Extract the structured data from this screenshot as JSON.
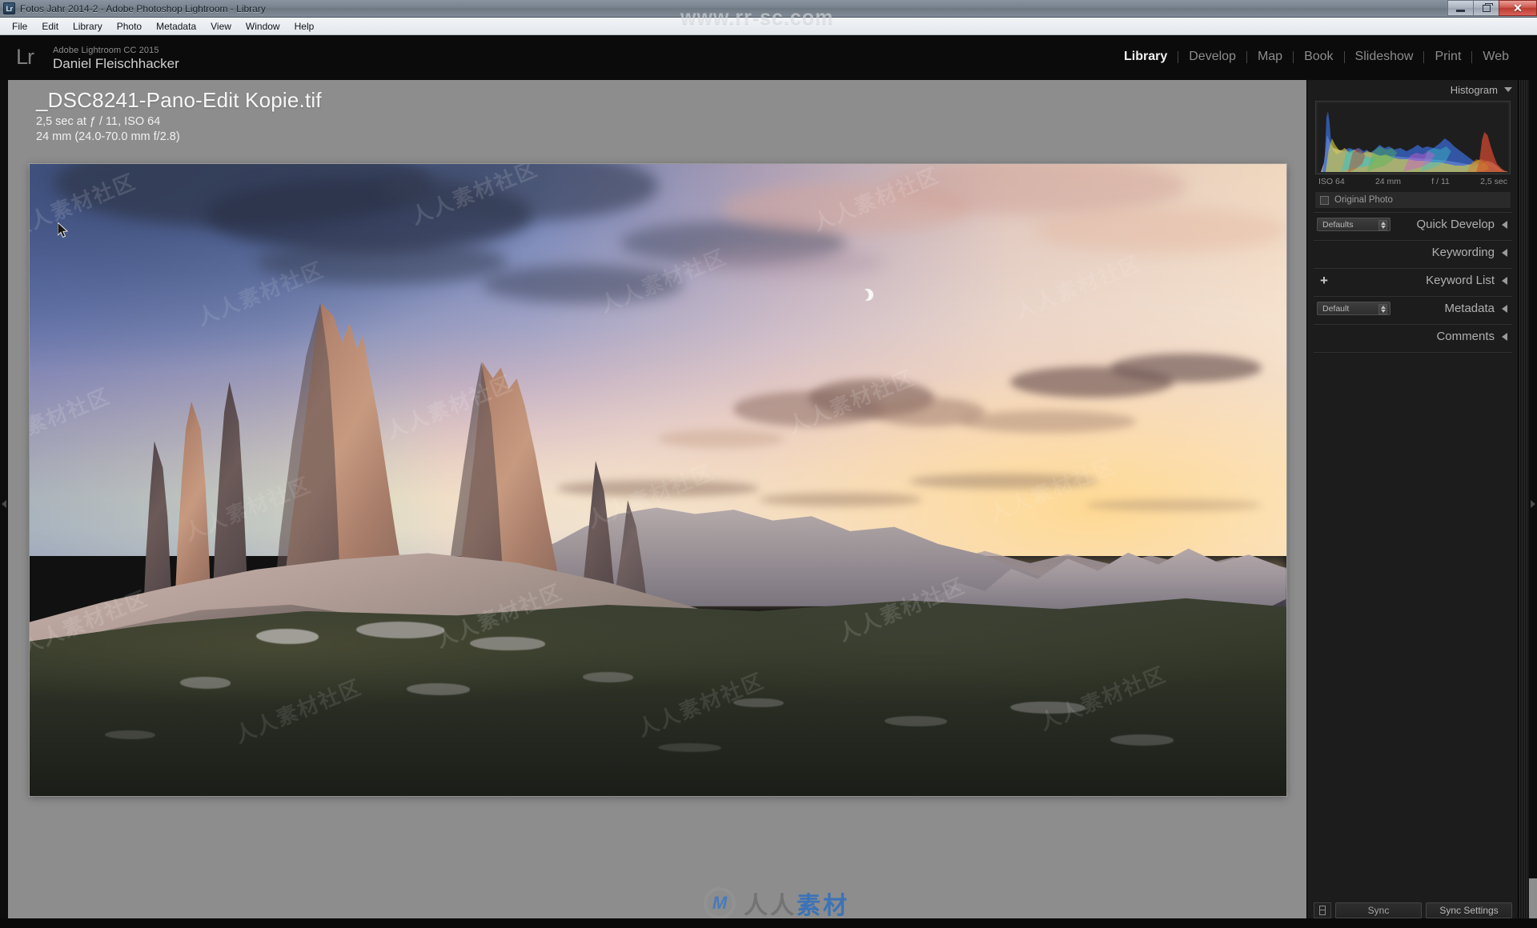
{
  "window": {
    "title": "Fotos Jahr 2014-2 - Adobe Photoshop Lightroom - Library",
    "app_icon_label": "Lr",
    "controls": {
      "minimize": "minimize-button",
      "maximize": "maximize-button",
      "close": "close-button",
      "close_glyph": "✕"
    }
  },
  "menubar": {
    "items": [
      {
        "label": "File"
      },
      {
        "label": "Edit"
      },
      {
        "label": "Library"
      },
      {
        "label": "Photo"
      },
      {
        "label": "Metadata"
      },
      {
        "label": "View"
      },
      {
        "label": "Window"
      },
      {
        "label": "Help"
      }
    ]
  },
  "watermarks": {
    "top_url": "www.rr-sc.com",
    "photo_tile": "人人素材社区",
    "bottom_text_left": "人人",
    "bottom_text_right": "素材"
  },
  "identity": {
    "logo": "Lr",
    "product": "Adobe Lightroom CC 2015",
    "owner": "Daniel Fleischhacker"
  },
  "modules": [
    {
      "label": "Library",
      "active": true
    },
    {
      "label": "Develop",
      "active": false
    },
    {
      "label": "Map",
      "active": false
    },
    {
      "label": "Book",
      "active": false
    },
    {
      "label": "Slideshow",
      "active": false
    },
    {
      "label": "Print",
      "active": false
    },
    {
      "label": "Web",
      "active": false
    }
  ],
  "photo_info": {
    "filename": "_DSC8241-Pano-Edit Kopie.tif",
    "exposure_line": "2,5 sec at ƒ / 11, ISO 64",
    "lens_line": "24 mm (24.0-70.0 mm f/2.8)"
  },
  "right_panel": {
    "histogram": {
      "title": "Histogram",
      "iso": "ISO 64",
      "focal": "24 mm",
      "aperture": "f / 11",
      "shutter": "2,5 sec"
    },
    "original_photo_label": "Original Photo",
    "sections": [
      {
        "id": "quick-develop",
        "title": "Quick Develop",
        "preset": "Defaults",
        "has_select": true,
        "has_plus": false
      },
      {
        "id": "keywording",
        "title": "Keywording",
        "preset": "",
        "has_select": false,
        "has_plus": false
      },
      {
        "id": "keyword-list",
        "title": "Keyword List",
        "preset": "",
        "has_select": false,
        "has_plus": true
      },
      {
        "id": "metadata",
        "title": "Metadata",
        "preset": "Default",
        "has_select": true,
        "has_plus": false
      },
      {
        "id": "comments",
        "title": "Comments",
        "preset": "",
        "has_select": false,
        "has_plus": false
      }
    ],
    "sync_button": "Sync",
    "sync_settings_button": "Sync Settings"
  },
  "colors": {
    "panel_bg": "#1c1c1c",
    "chrome_bg": "#0b0b0b",
    "canvas_bg": "#8d8d8d",
    "active_module": "#f2f2f2",
    "inactive_module": "#8c8c8c"
  }
}
